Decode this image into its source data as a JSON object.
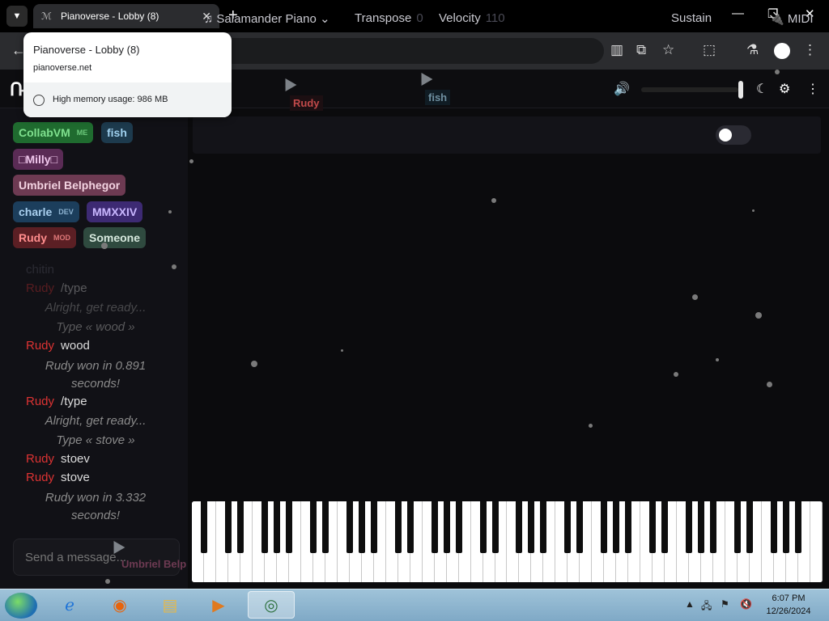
{
  "browser": {
    "tab_title": "Pianoverse - Lobby (8)",
    "new_tab": "+",
    "tab_close": "✕",
    "popup": {
      "title": "Pianoverse - Lobby (8)",
      "url": "pianoverse.net",
      "memory": "High memory usage: 986 MB"
    }
  },
  "header": {
    "logo": "Ռ",
    "cursors": [
      {
        "name": "Rudy",
        "color": "#c14a4a"
      },
      {
        "name": "fish",
        "color": "#6f8fa0"
      }
    ]
  },
  "sidebar": {
    "users": [
      {
        "name": "CollabVM",
        "tag": "ME",
        "bg": "#1f6b2f",
        "fg": "#7fe08e"
      },
      {
        "name": "fish",
        "tag": "",
        "bg": "#1d3a4d",
        "fg": "#9fd0ee"
      },
      {
        "name": "□Milly□",
        "tag": "",
        "bg": "#5a2b55",
        "fg": "#f0c7ec"
      },
      {
        "name": "Umbriel Belphegor",
        "tag": "",
        "bg": "#6d3a52",
        "fg": "#f3d3e1"
      },
      {
        "name": "charle",
        "tag": "DEV",
        "bg": "#1c3e5c",
        "fg": "#a9cfee"
      },
      {
        "name": "MMXXIV",
        "tag": "",
        "bg": "#3d2a73",
        "fg": "#c9b7ff"
      },
      {
        "name": "Rudy",
        "tag": "MOD",
        "bg": "#5b1f24",
        "fg": "#ff8d8d"
      },
      {
        "name": "Someone",
        "tag": "",
        "bg": "#2f4a3f",
        "fg": "#d6e8dd"
      }
    ],
    "chat": {
      "faded_top": "chitin",
      "rudy": "Rudy",
      "cmd_type": "/type",
      "ready": "Alright, get ready...",
      "type_wood": "Type « wood »",
      "wood": "wood",
      "won_wood": "Rudy won in 0.891 seconds!",
      "type_stove": "Type « stove »",
      "stoev": "stoev",
      "stove": "stove",
      "won_stove": "Rudy won in 3.332 seconds!"
    },
    "message_placeholder": "Send a message...",
    "cursor_overlay": "Umbriel Belp"
  },
  "instrument_bar": {
    "instrument": "Salamander Piano",
    "transpose_label": "Transpose",
    "transpose_value": "0",
    "velocity_label": "Velocity",
    "velocity_value": "110",
    "sustain_label": "Sustain",
    "sustain_on": false,
    "midi_label": "MIDI"
  },
  "taskbar": {
    "time": "6:07 PM",
    "date": "12/26/2024"
  }
}
